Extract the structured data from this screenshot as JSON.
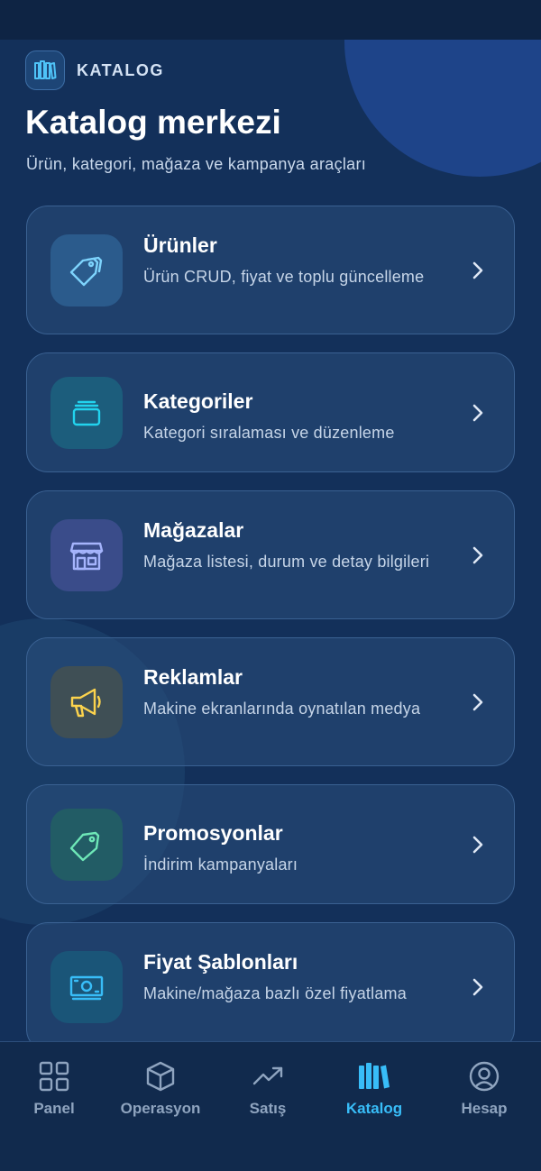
{
  "header": {
    "badge_label": "KATALOG",
    "title": "Katalog merkezi",
    "subtitle": "Ürün, kategori, mağaza ve kampanya araçları"
  },
  "cards": [
    {
      "title": "Ürünler",
      "description": "Ürün CRUD, fiyat ve toplu güncelleme",
      "icon": "tags-icon",
      "accent": "#7dd3fc"
    },
    {
      "title": "Kategoriler",
      "description": "Kategori sıralaması ve düzenleme",
      "icon": "layers-icon",
      "accent": "#22d3ee"
    },
    {
      "title": "Mağazalar",
      "description": "Mağaza listesi, durum ve detay bilgileri",
      "icon": "store-icon",
      "accent": "#a5b4fc"
    },
    {
      "title": "Reklamlar",
      "description": "Makine ekranlarında oynatılan medya",
      "icon": "megaphone-icon",
      "accent": "#fcd34d"
    },
    {
      "title": "Promosyonlar",
      "description": "İndirim kampanyaları",
      "icon": "tag-icon",
      "accent": "#6ee7b7"
    },
    {
      "title": "Fiyat Şablonları",
      "description": "Makine/mağaza bazlı özel fiyatlama",
      "icon": "banknote-icon",
      "accent": "#38bdf8"
    }
  ],
  "tabbar": {
    "items": [
      {
        "label": "Panel",
        "icon": "grid-icon"
      },
      {
        "label": "Operasyon",
        "icon": "box-icon"
      },
      {
        "label": "Satış",
        "icon": "trending-up-icon"
      },
      {
        "label": "Katalog",
        "icon": "library-icon",
        "active": true
      },
      {
        "label": "Hesap",
        "icon": "user-circle-icon"
      }
    ],
    "active_color": "#38bdf8",
    "inactive_color": "#8fa4bf"
  }
}
